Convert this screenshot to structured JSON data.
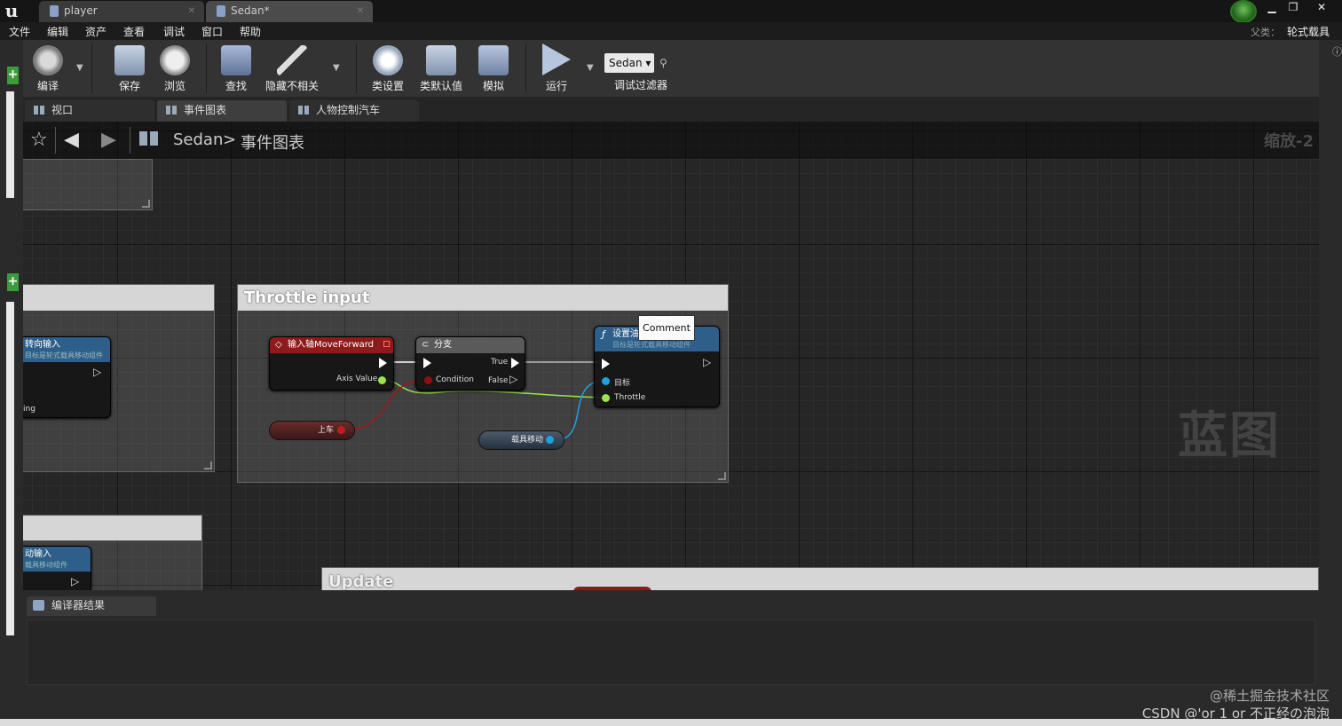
{
  "titlebar": {
    "logo": "u",
    "tabs": [
      {
        "label": "player"
      },
      {
        "label": "Sedan*"
      }
    ],
    "window_buttons": [
      "▁",
      "❐",
      "✕"
    ]
  },
  "menu": {
    "items": [
      "文件",
      "编辑",
      "资产",
      "查看",
      "调试",
      "窗口",
      "帮助"
    ],
    "parent_label": "父类：",
    "parent_value": "轮式载具"
  },
  "toolbar": {
    "compile": "编译",
    "save": "保存",
    "browse": "浏览",
    "find": "查找",
    "hide_unrelated": "隐藏不相关",
    "class_settings": "类设置",
    "class_defaults": "类默认值",
    "simulate": "模拟",
    "run": "运行",
    "debug_selected": "Sedan",
    "debug_filter": "调试过滤器"
  },
  "panel_tabs": [
    {
      "label": "视口"
    },
    {
      "label": "事件图表"
    },
    {
      "label": "人物控制汽车"
    }
  ],
  "graph": {
    "breadcrumb_root": "Sedan",
    "breadcrumb_sep": ">",
    "breadcrumb_current": "事件图表",
    "zoom": "缩放-2",
    "left_node_title": "转向输入",
    "left_node_subtitle": "目标是轮式载具移动组件",
    "left_node_pin": "ing",
    "bottom_node_title": "动输入",
    "bottom_node_subtitle": "载具移动组件",
    "comment_main": "Throttle input",
    "comment_update": "Update",
    "input_node": {
      "title": "输入轴MoveForward",
      "pin_axis": "Axis Value"
    },
    "branch_node": {
      "title": "分支",
      "pin_condition": "Condition",
      "pin_true": "True",
      "pin_false": "False"
    },
    "set_node": {
      "title": "设置油",
      "subtitle": "目标是轮式载具移动组件",
      "pin_target": "目标",
      "pin_throttle": "Throttle"
    },
    "var_onboard": "上车",
    "var_vehicle_movement": "载具移动",
    "tooltip": "Comment",
    "watermark": "蓝图"
  },
  "compiler": {
    "tab_label": "编译器结果"
  },
  "credits": {
    "line1": "@稀土掘金技术社区",
    "line2": "CSDN @'or 1 or 不正经の泡泡"
  },
  "colors": {
    "input_head": "#8e1b1b",
    "branch_head": "#5a5a5a",
    "function_head": "#2d5f8a",
    "float_pin": "#9be34a",
    "bool_pin": "#8c1111",
    "object_pin": "#1fa0e0"
  }
}
